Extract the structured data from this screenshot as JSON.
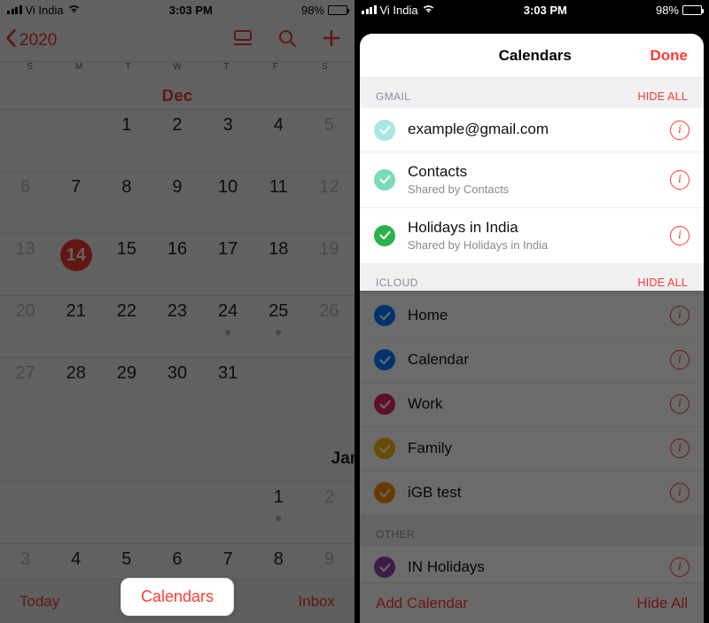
{
  "status": {
    "carrier": "Vi India",
    "time": "3:03 PM",
    "battery_pct": "98%"
  },
  "left": {
    "back_year": "2020",
    "month": "Dec",
    "next_month": "Jan",
    "weekdays": [
      "S",
      "M",
      "T",
      "W",
      "T",
      "F",
      "S"
    ],
    "weeks": [
      [
        "",
        "",
        "1",
        "2",
        "3",
        "4",
        "5"
      ],
      [
        "6",
        "7",
        "8",
        "9",
        "10",
        "11",
        "12"
      ],
      [
        "13",
        "14",
        "15",
        "16",
        "17",
        "18",
        "19"
      ],
      [
        "20",
        "21",
        "22",
        "23",
        "24",
        "25",
        "26"
      ],
      [
        "27",
        "28",
        "29",
        "30",
        "31",
        "",
        ""
      ]
    ],
    "jan_weeks": [
      [
        "",
        "",
        "",
        "",
        "",
        "1",
        "2"
      ],
      [
        "3",
        "4",
        "5",
        "6",
        "7",
        "8",
        "9"
      ]
    ],
    "today_label": "Today",
    "calendars_label": "Calendars",
    "inbox_label": "Inbox",
    "today_cell": "14",
    "dot_cells": [
      "24",
      "25",
      "1b"
    ]
  },
  "right": {
    "title": "Calendars",
    "done": "Done",
    "hide_all": "HIDE ALL",
    "sections": {
      "gmail": {
        "header": "GMAIL",
        "items": [
          {
            "label": "example@gmail.com",
            "sub": "",
            "color": "#a8e6e1"
          },
          {
            "label": "Contacts",
            "sub": "Shared by Contacts",
            "color": "#79dcb5"
          },
          {
            "label": "Holidays in India",
            "sub": "Shared by Holidays in India",
            "color": "#2bb24c"
          }
        ]
      },
      "icloud": {
        "header": "ICLOUD",
        "items": [
          {
            "label": "Home",
            "sub": "",
            "color": "#007aff"
          },
          {
            "label": "Calendar",
            "sub": "",
            "color": "#007aff"
          },
          {
            "label": "Work",
            "sub": "",
            "color": "#e0245e"
          },
          {
            "label": "Family",
            "sub": "",
            "color": "#f5b700"
          },
          {
            "label": "iGB test",
            "sub": "",
            "color": "#f58a00"
          }
        ]
      },
      "other": {
        "header": "OTHER",
        "items": [
          {
            "label": "IN Holidays",
            "sub": "",
            "color": "#8e44ad"
          }
        ]
      }
    },
    "footer": {
      "add": "Add Calendar",
      "hideall": "Hide All"
    }
  }
}
